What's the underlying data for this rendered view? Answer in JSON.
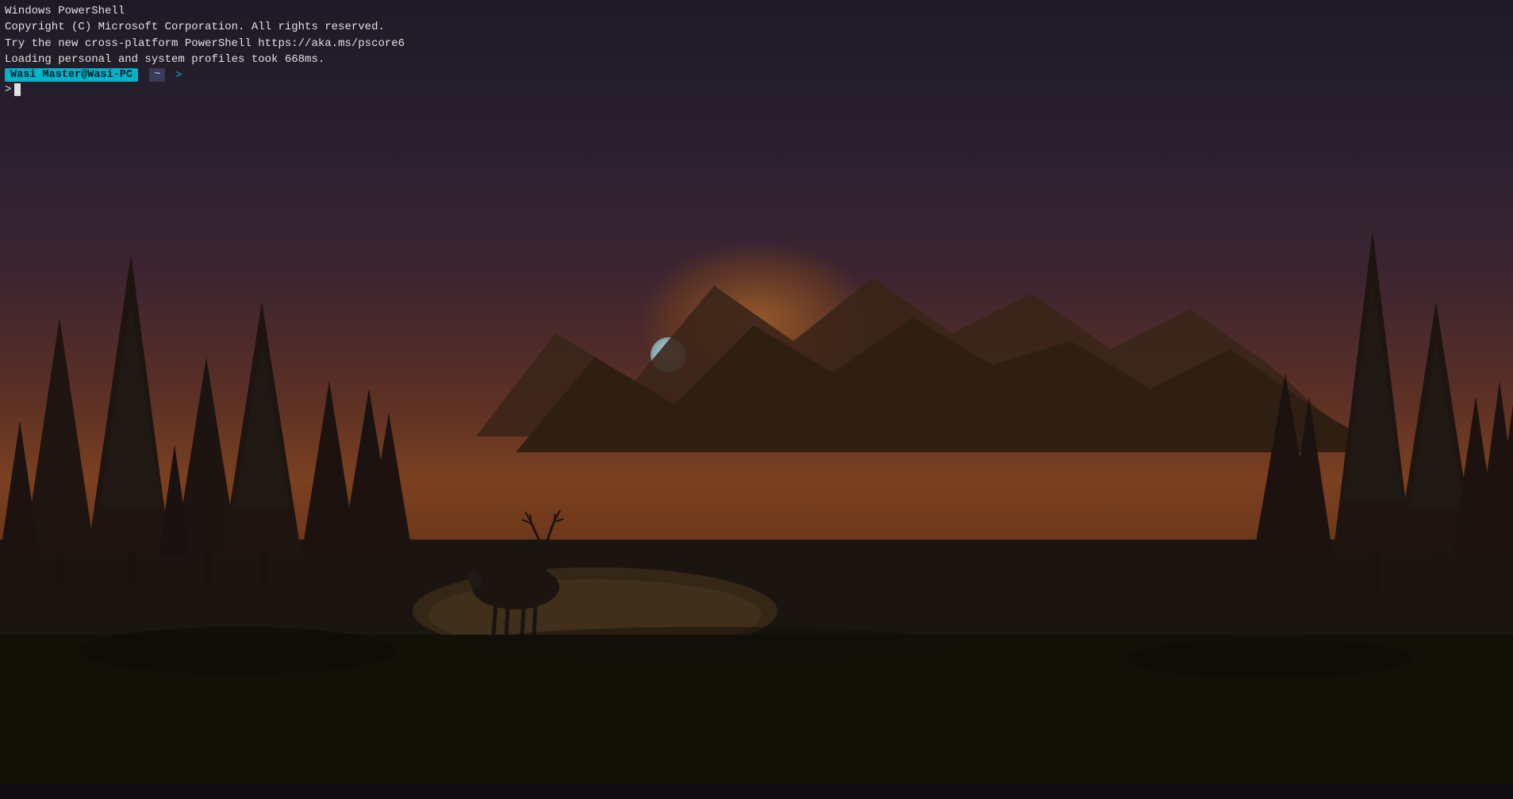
{
  "terminal": {
    "line1": "Windows PowerShell",
    "line2": "Copyright (C) Microsoft Corporation. All rights reserved.",
    "line3": "Try the new cross-platform PowerShell https://aka.ms/pscore6",
    "line4": "Loading personal and system profiles took 668ms.",
    "prompt_user": "Wasi Master@Wasi-PC",
    "prompt_tilde": "~",
    "prompt_arrow": ">",
    "input_gt": ">",
    "colors": {
      "prompt_bg": "#00b4c8",
      "prompt_text": "#1a1a2e",
      "tilde_bg": "#3a3a5a"
    }
  }
}
